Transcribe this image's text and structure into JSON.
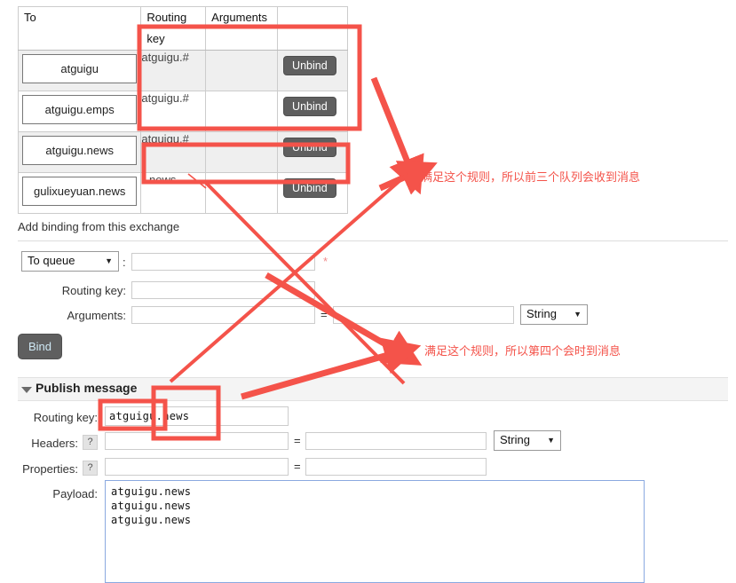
{
  "bindings": {
    "columns": [
      "To",
      "Routing key",
      "Arguments",
      ""
    ],
    "rows": [
      {
        "to": "atguigu",
        "routing_key": "atguigu.#",
        "arguments": "",
        "action": "Unbind"
      },
      {
        "to": "atguigu.emps",
        "routing_key": "atguigu.#",
        "arguments": "",
        "action": "Unbind"
      },
      {
        "to": "atguigu.news",
        "routing_key": "atguigu.#",
        "arguments": "",
        "action": "Unbind"
      },
      {
        "to": "gulixueyuan.news",
        "routing_key": "*.news",
        "arguments": "",
        "action": "Unbind"
      }
    ]
  },
  "add_binding": {
    "heading": "Add binding from this exchange",
    "target_select": "To queue",
    "target_value": "",
    "target_required_mark": "*",
    "colon": ":",
    "routing_key_label": "Routing key:",
    "routing_key_value": "",
    "arguments_label": "Arguments:",
    "arguments_key_value": "",
    "arguments_eq": "=",
    "arguments_val_value": "",
    "arguments_type": "String",
    "bind_button": "Bind"
  },
  "publish": {
    "title": "Publish message",
    "routing_key_label": "Routing key:",
    "routing_key_value": "atguigu.news",
    "headers_label": "Headers:",
    "headers_help": "?",
    "headers_key_value": "",
    "headers_eq": "=",
    "headers_val_value": "",
    "headers_type": "String",
    "properties_label": "Properties:",
    "properties_help": "?",
    "properties_key_value": "",
    "properties_eq": "=",
    "properties_val_value": "",
    "payload_label": "Payload:",
    "payload_value": "atguigu.news\natguigu.news\natguigu.news"
  },
  "annotations": {
    "note_top": "满足这个规则，所以前三个队列会收到消息",
    "note_bottom": "满足这个规则，所以第四个会时到消息",
    "accent_color": "#f4534a"
  }
}
